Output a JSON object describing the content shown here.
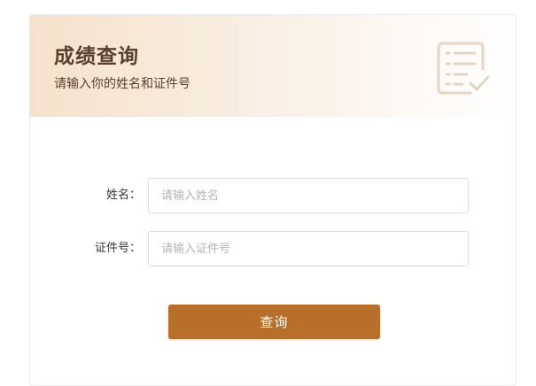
{
  "header": {
    "title": "成绩查询",
    "subtitle": "请输入你的姓名和证件号",
    "icon": "checklist-icon"
  },
  "form": {
    "name_label": "姓名：",
    "name_placeholder": "请输入姓名",
    "name_value": "",
    "id_label": "证件号：",
    "id_placeholder": "请输入证件号",
    "id_value": "",
    "submit_label": "查询"
  },
  "colors": {
    "accent": "#b86f2a",
    "title_text": "#5a3f2c",
    "header_gradient_start": "#f6e2cb",
    "icon_stroke": "#e6d5c4"
  }
}
